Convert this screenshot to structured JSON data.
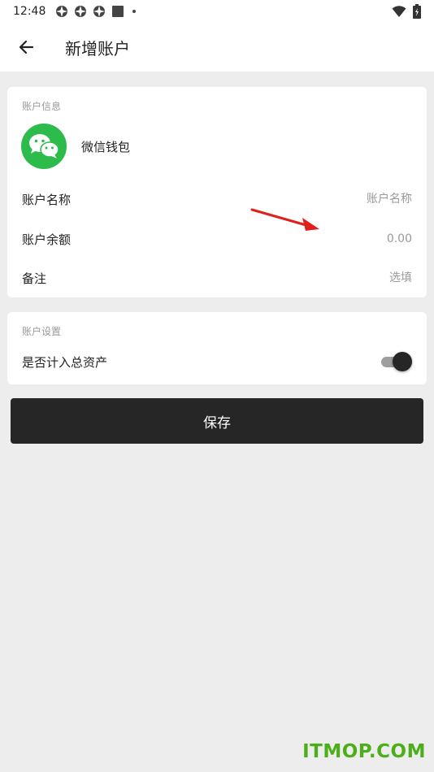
{
  "status_bar": {
    "time": "12:48",
    "icons": [
      "vpn-icon",
      "vpn-icon",
      "vpn-icon",
      "square-icon",
      "dot-icon"
    ],
    "right_icons": [
      "wifi-icon",
      "battery-icon"
    ]
  },
  "app_bar": {
    "back_icon": "arrow-left-icon",
    "title": "新增账户"
  },
  "account_info": {
    "section_label": "账户信息",
    "wallet": {
      "icon": "wechat-icon",
      "name": "微信钱包",
      "color": "#2dbb4b"
    },
    "name_field": {
      "label": "账户名称",
      "value": "",
      "placeholder": "账户名称"
    },
    "balance_field": {
      "label": "账户余额",
      "value": "",
      "placeholder": "0.00"
    },
    "note_field": {
      "label": "备注",
      "value": "",
      "placeholder": "选填"
    }
  },
  "account_settings": {
    "section_label": "账户设置",
    "include_total": {
      "label": "是否计入总资产",
      "checked": true
    }
  },
  "save_button": {
    "label": "保存",
    "color": "#262626"
  },
  "annotation": {
    "icon": "red-arrow-icon",
    "color": "#e0201c"
  },
  "watermark": {
    "text": "ITMOP.COM",
    "color": "#4caf1a"
  }
}
